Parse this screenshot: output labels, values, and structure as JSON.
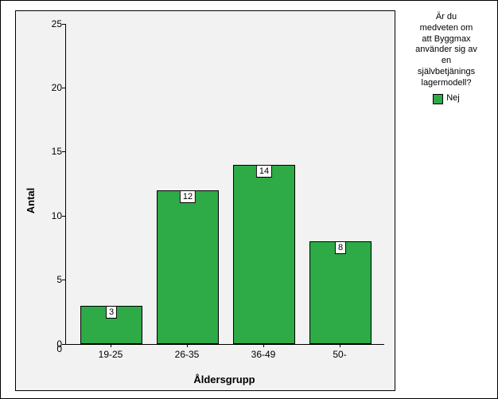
{
  "chart_data": {
    "type": "bar",
    "title": "",
    "xlabel": "Åldersgrupp",
    "ylabel": "Antal",
    "categories": [
      "19-25",
      "26-35",
      "36-49",
      "50-"
    ],
    "series": [
      {
        "name": "Nej",
        "values": [
          3,
          12,
          14,
          8
        ],
        "color": "#2eaa46"
      }
    ],
    "ylim": [
      0,
      25
    ],
    "yticks": [
      0,
      5,
      10,
      15,
      20,
      25
    ],
    "legend_title": "Är du\nmedveten om\natt Byggmax\nanvänder sig av\nen\nsjälvbetjänings\nlagermodell?"
  }
}
